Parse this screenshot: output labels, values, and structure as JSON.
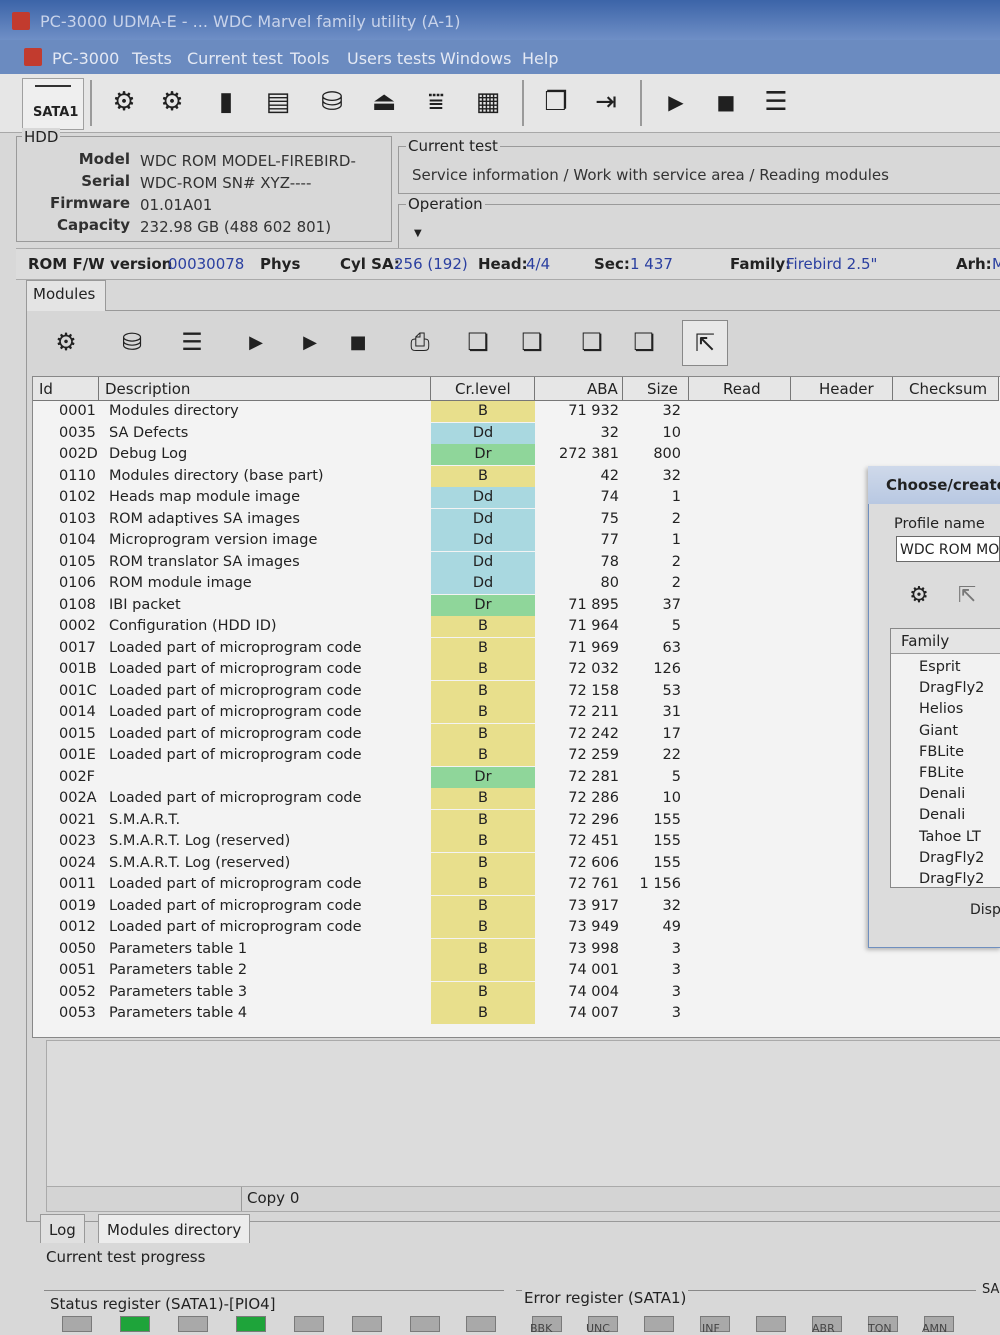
{
  "window": {
    "title": "PC-3000 UDMA-E - ... WDC Marvel family utility (A-1)"
  },
  "menu": [
    "PC-3000",
    "Tests",
    "Current test",
    "Tools",
    "Users tests",
    "Windows",
    "Help"
  ],
  "toolbar": {
    "port_label": "SATA1"
  },
  "hdd": {
    "group_title": "HDD",
    "model_label": "Model",
    "model": "WDC ROM MODEL-FIREBIRD-",
    "serial_label": "Serial",
    "serial": "WDC-ROM SN# XYZ----",
    "firmware_label": "Firmware",
    "firmware": "01.01A01",
    "capacity_label": "Capacity",
    "capacity": "232.98 GB (488 602 801)"
  },
  "current_test": {
    "group_title": "Current test",
    "path": "Service information / Work with service area / Reading modules"
  },
  "operation": {
    "group_title": "Operation"
  },
  "status_line": {
    "rom_fw_label": "ROM F/W version",
    "rom_fw": "00030078",
    "phys_label": "Phys",
    "cyl_label": "Cyl SA:",
    "cyl": "256 (192)",
    "head_label": "Head:",
    "head": "4/4",
    "sec_label": "Sec:",
    "sec": "1 437",
    "family_label": "Family:",
    "family": "Firebird 2.5\"",
    "arh_label": "Arh:",
    "arh": "M"
  },
  "modules_tab": {
    "label": "Modules"
  },
  "grid": {
    "columns": [
      "Id",
      "Description",
      "Cr.level",
      "ABA",
      "Size",
      "Read",
      "Header",
      "Checksum"
    ],
    "rows": [
      {
        "id": "0001",
        "desc": "Modules directory",
        "lvl": "B",
        "aba": "71 932",
        "size": "32"
      },
      {
        "id": "0035",
        "desc": "SA Defects",
        "lvl": "Dd",
        "aba": "32",
        "size": "10"
      },
      {
        "id": "002D",
        "desc": "Debug Log",
        "lvl": "Dr",
        "aba": "272 381",
        "size": "800"
      },
      {
        "id": "0110",
        "desc": "Modules directory (base part)",
        "lvl": "B",
        "aba": "42",
        "size": "32"
      },
      {
        "id": "0102",
        "desc": "Heads map module image",
        "lvl": "Dd",
        "aba": "74",
        "size": "1"
      },
      {
        "id": "0103",
        "desc": "ROM adaptives SA images",
        "lvl": "Dd",
        "aba": "75",
        "size": "2"
      },
      {
        "id": "0104",
        "desc": "Microprogram version image",
        "lvl": "Dd",
        "aba": "77",
        "size": "1"
      },
      {
        "id": "0105",
        "desc": "ROM translator SA images",
        "lvl": "Dd",
        "aba": "78",
        "size": "2"
      },
      {
        "id": "0106",
        "desc": "ROM module image",
        "lvl": "Dd",
        "aba": "80",
        "size": "2"
      },
      {
        "id": "0108",
        "desc": "IBI packet",
        "lvl": "Dr",
        "aba": "71 895",
        "size": "37"
      },
      {
        "id": "0002",
        "desc": "Configuration (HDD ID)",
        "lvl": "B",
        "aba": "71 964",
        "size": "5"
      },
      {
        "id": "0017",
        "desc": "Loaded part of microprogram code",
        "lvl": "B",
        "aba": "71 969",
        "size": "63"
      },
      {
        "id": "001B",
        "desc": "Loaded part of microprogram code",
        "lvl": "B",
        "aba": "72 032",
        "size": "126"
      },
      {
        "id": "001C",
        "desc": "Loaded part of microprogram code",
        "lvl": "B",
        "aba": "72 158",
        "size": "53"
      },
      {
        "id": "0014",
        "desc": "Loaded part of microprogram code",
        "lvl": "B",
        "aba": "72 211",
        "size": "31"
      },
      {
        "id": "0015",
        "desc": "Loaded part of microprogram code",
        "lvl": "B",
        "aba": "72 242",
        "size": "17"
      },
      {
        "id": "001E",
        "desc": "Loaded part of microprogram code",
        "lvl": "B",
        "aba": "72 259",
        "size": "22"
      },
      {
        "id": "002F",
        "desc": "",
        "lvl": "Dr",
        "aba": "72 281",
        "size": "5"
      },
      {
        "id": "002A",
        "desc": "Loaded part of microprogram code",
        "lvl": "B",
        "aba": "72 286",
        "size": "10"
      },
      {
        "id": "0021",
        "desc": "S.M.A.R.T.",
        "lvl": "B",
        "aba": "72 296",
        "size": "155"
      },
      {
        "id": "0023",
        "desc": "S.M.A.R.T. Log (reserved)",
        "lvl": "B",
        "aba": "72 451",
        "size": "155"
      },
      {
        "id": "0024",
        "desc": "S.M.A.R.T. Log (reserved)",
        "lvl": "B",
        "aba": "72 606",
        "size": "155"
      },
      {
        "id": "0011",
        "desc": "Loaded part of microprogram code",
        "lvl": "B",
        "aba": "72 761",
        "size": "1 156"
      },
      {
        "id": "0019",
        "desc": "Loaded part of microprogram code",
        "lvl": "B",
        "aba": "73 917",
        "size": "32"
      },
      {
        "id": "0012",
        "desc": "Loaded part of microprogram code",
        "lvl": "B",
        "aba": "73 949",
        "size": "49"
      },
      {
        "id": "0050",
        "desc": "Parameters table 1",
        "lvl": "B",
        "aba": "73 998",
        "size": "3"
      },
      {
        "id": "0051",
        "desc": "Parameters table 2",
        "lvl": "B",
        "aba": "74 001",
        "size": "3"
      },
      {
        "id": "0052",
        "desc": "Parameters table 3",
        "lvl": "B",
        "aba": "74 004",
        "size": "3"
      },
      {
        "id": "0053",
        "desc": "Parameters table 4",
        "lvl": "B",
        "aba": "74 007",
        "size": "3"
      }
    ],
    "level_colors": {
      "B": "#e8df8c",
      "Dd": "#a9d8e0",
      "Dr": "#8fd69a"
    }
  },
  "copy_bar": {
    "label": "Copy 0"
  },
  "log_tabs": [
    "Log",
    "Modules directory"
  ],
  "progress": {
    "label": "Current test progress"
  },
  "status_register": {
    "title": "Status register (SATA1)-[PIO4]"
  },
  "error_register": {
    "title": "Error register (SATA1)",
    "leds": [
      "",
      "BBK",
      "UNC",
      "",
      "INF",
      "",
      "ABR",
      "TON",
      "AMN"
    ]
  },
  "sa_corner": {
    "label": "SA"
  },
  "dialog": {
    "title": "Choose/create p",
    "profile_name_label": "Profile name",
    "profile_name_value": "WDC ROM MO",
    "family_header": "Family",
    "families": [
      "Esprit",
      "DragFly2",
      "Helios",
      "Giant",
      "FBLite",
      "FBLite",
      "Denali",
      "Denali",
      "Tahoe LT",
      "DragFly2",
      "DragFly2"
    ],
    "disp_label": "Disp"
  }
}
